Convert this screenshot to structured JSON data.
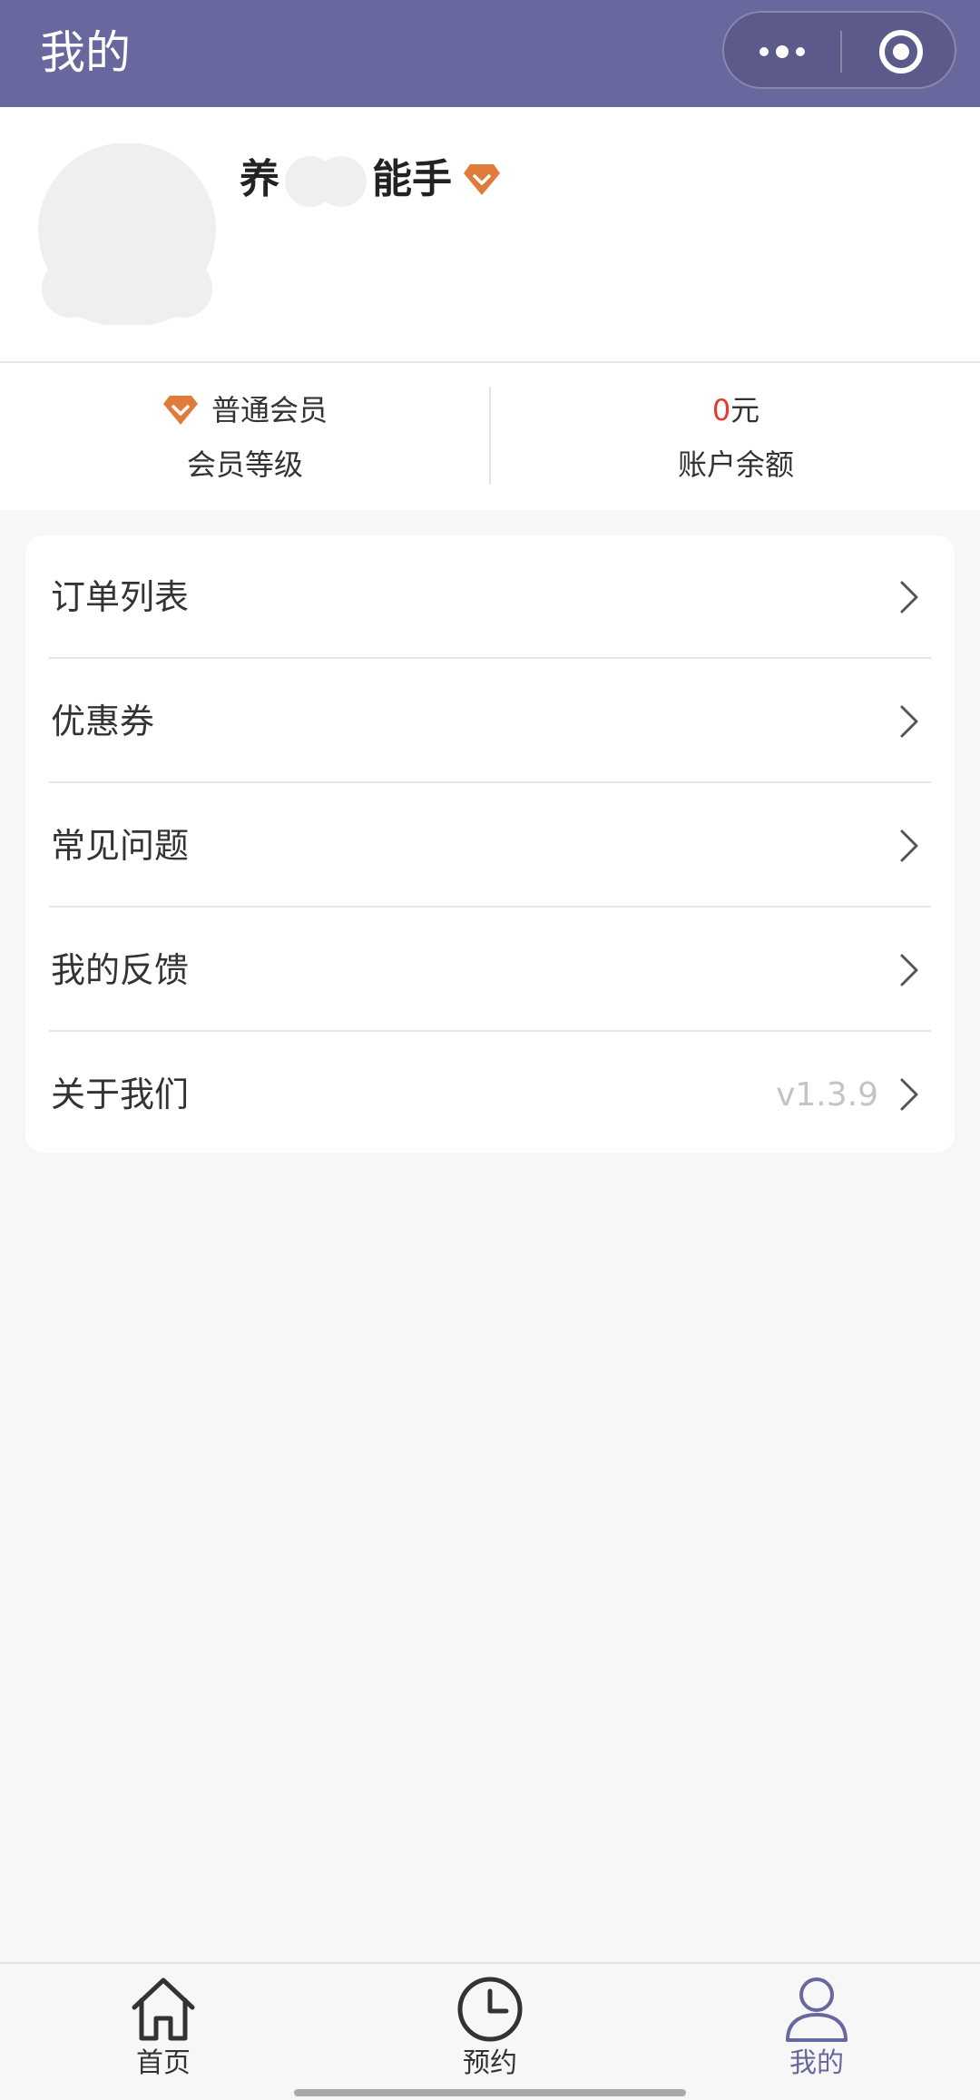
{
  "header": {
    "title": "我的",
    "capsule": {
      "more_icon": "more-dots-icon",
      "close_icon": "target-circle-icon"
    },
    "color": "#68679e"
  },
  "profile": {
    "name_prefix": "养",
    "name_suffix": "能手",
    "badge_icon": "diamond-badge-icon"
  },
  "stats": {
    "member_level_value": "普通会员",
    "member_level_label": "会员等级",
    "balance_amount": "0",
    "balance_unit": "元",
    "balance_label": "账户余额",
    "amount_color": "#e53b2f",
    "badge_color": "#e07b3a"
  },
  "menu": {
    "items": [
      {
        "label": "订单列表",
        "icon": "chevron-right-icon"
      },
      {
        "label": "优惠券",
        "icon": "chevron-right-icon"
      },
      {
        "label": "常见问题",
        "icon": "chevron-right-icon"
      },
      {
        "label": "我的反馈",
        "icon": "chevron-right-icon"
      },
      {
        "label": "关于我们",
        "icon": "chevron-right-icon",
        "value": "v1.3.9"
      }
    ]
  },
  "tabbar": {
    "tabs": [
      {
        "label": "首页",
        "icon": "home-icon",
        "active": false
      },
      {
        "label": "预约",
        "icon": "clock-icon",
        "active": false
      },
      {
        "label": "我的",
        "icon": "user-icon",
        "active": true
      }
    ],
    "active_color": "#68679e"
  }
}
